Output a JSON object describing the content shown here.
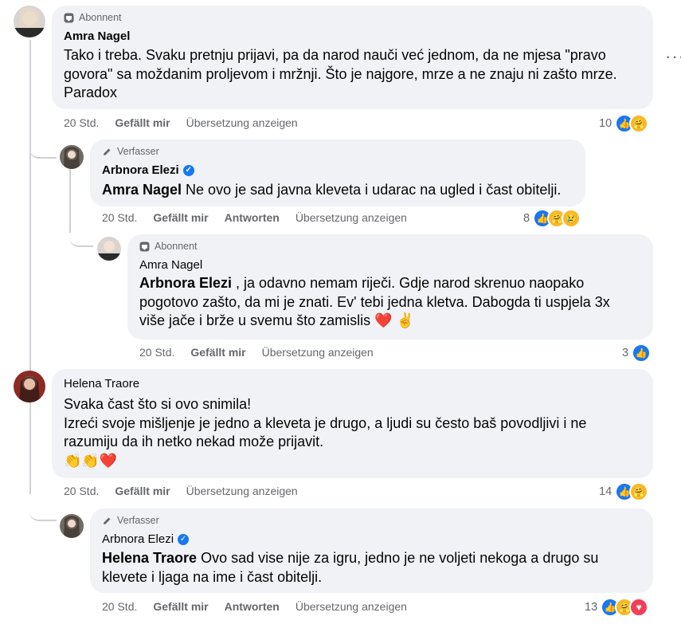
{
  "comments": [
    {
      "badge": "Abonnent",
      "author": "Amra Nagel",
      "text": "Tako i treba. Svaku pretnju prijavi, pa da narod nauči već jednom, da ne mjesa \"pravo\ngovora\" sa moždanim proljevom i mržnji. Što je najgore, mrze a ne znaju ni zašto mrze.\nParadox",
      "time": "20 Std.",
      "like": "Gefällt mir",
      "translate": "Übersetzung anzeigen",
      "reaction_count": "10",
      "reaction_icons": [
        "like-icon",
        "care-icon"
      ]
    },
    {
      "badge": "Verfasser",
      "author": "Arbnora Elezi",
      "mention": "Amra Nagel",
      "text": " Ne ovo je sad javna kleveta i udarac na ugled i čast obitelji.",
      "time": "20 Std.",
      "like": "Gefällt mir",
      "reply": "Antworten",
      "translate": "Übersetzung anzeigen",
      "reaction_count": "8",
      "reaction_icons": [
        "like-icon",
        "care-icon",
        "sad-icon"
      ]
    },
    {
      "badge": "Abonnent",
      "author": "Amra Nagel",
      "mention": "Arbnora Elezi",
      "text": " , ja odavno nemam riječi. Gdje narod skrenuo naopako\npogotovo zašto, da mi je znati. Ev' tebi jedna kletva. Dabogda ti uspjela 3x\nviše jače i brže u svemu što zamislis ❤️ ✌️",
      "time": "20 Std.",
      "like": "Gefällt mir",
      "translate": "Übersetzung anzeigen",
      "reaction_count": "3",
      "reaction_icons": [
        "like-icon"
      ]
    },
    {
      "author": "Helena Traore",
      "text": "Svaka čast što si ovo snimila!\nIzreći svoje mišljenje je jedno a kleveta je drugo, a ljudi su često baš povodljivi i ne\nrazumiju da ih netko nekad može prijavit.\n👏👏❤️",
      "time": "20 Std.",
      "like": "Gefällt mir",
      "translate": "Übersetzung anzeigen",
      "reaction_count": "14",
      "reaction_icons": [
        "like-icon",
        "care-icon"
      ]
    },
    {
      "badge": "Verfasser",
      "author": "Arbnora Elezi",
      "mention": "Helena Traore",
      "text": " Ovo sad vise nije za igru, jedno je ne voljeti nekoga a drugo su\nklevete i ljaga na ime i čast obitelji.",
      "time": "20 Std.",
      "like": "Gefällt mir",
      "reply": "Antworten",
      "translate": "Übersetzung anzeigen",
      "reaction_count": "13",
      "reaction_icons": [
        "like-icon",
        "care-icon",
        "love-icon"
      ]
    }
  ],
  "more_options": "···",
  "colors": {
    "bubble": "#f0f2f5",
    "secondary_text": "#65676b",
    "like": "#1877f2",
    "love": "#f33e58",
    "care": "#f7b928"
  }
}
